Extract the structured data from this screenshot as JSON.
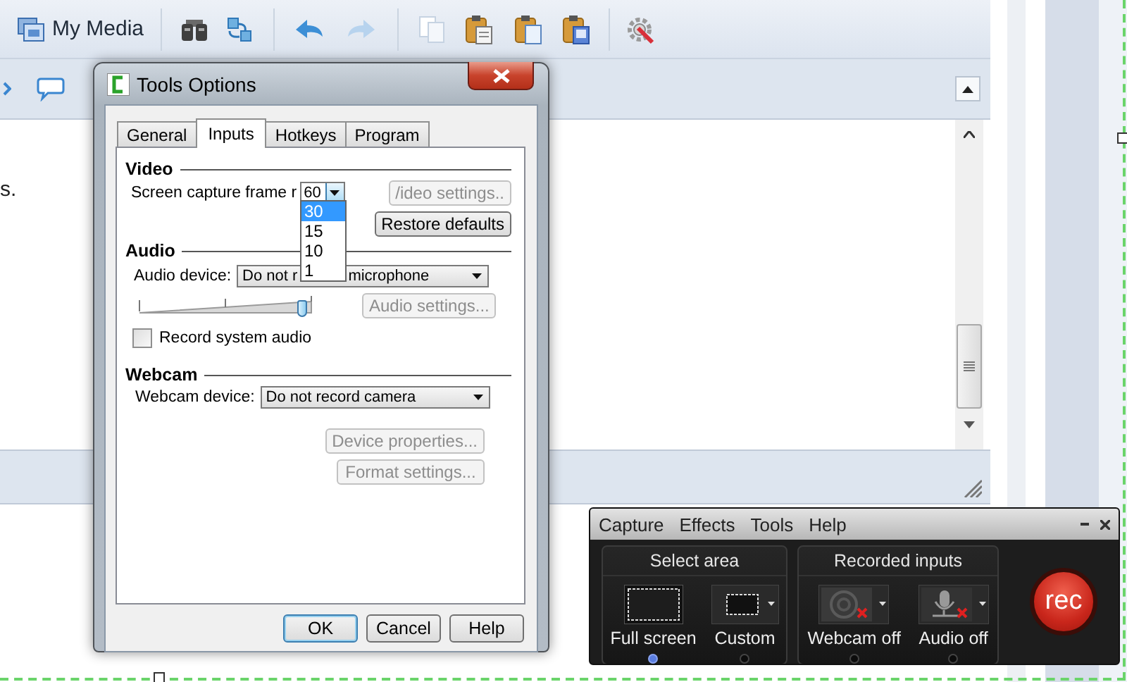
{
  "app": {
    "media_button": "My Media",
    "document_text": "s."
  },
  "dialog": {
    "title": "Tools Options",
    "tabs": [
      {
        "label": "General",
        "selected": false
      },
      {
        "label": "Inputs",
        "selected": true
      },
      {
        "label": "Hotkeys",
        "selected": false
      },
      {
        "label": "Program",
        "selected": false
      }
    ],
    "video": {
      "heading": "Video",
      "frame_rate_label": "Screen capture frame r",
      "frame_rate_value": "60",
      "frame_rate_expanded": true,
      "frame_rate_options": [
        {
          "label": "30",
          "selected": true
        },
        {
          "label": "15",
          "selected": false
        },
        {
          "label": "10",
          "selected": false
        },
        {
          "label": "1",
          "selected": false
        }
      ],
      "settings_button": {
        "label": "/ideo settings..",
        "disabled": true
      },
      "restore_button": {
        "label": "Restore defaults",
        "disabled": false
      }
    },
    "audio": {
      "heading": "Audio",
      "device_label": "Audio device:",
      "device_value_parts": [
        "Do not r",
        "microphone"
      ],
      "volume": {
        "level": 0.97
      },
      "settings_button": {
        "label": "Audio settings...",
        "disabled": true
      },
      "record_system_audio": {
        "label": "Record system audio",
        "checked": false
      }
    },
    "webcam": {
      "heading": "Webcam",
      "device_label": "Webcam device:",
      "device_value": "Do not record camera",
      "properties_button": {
        "label": "Device properties...",
        "disabled": true
      },
      "format_button": {
        "label": "Format settings...",
        "disabled": true
      }
    },
    "buttons": [
      {
        "label": "OK",
        "default": true
      },
      {
        "label": "Cancel",
        "default": false
      },
      {
        "label": "Help",
        "default": false
      }
    ]
  },
  "recorder": {
    "menu": [
      "Capture",
      "Effects",
      "Tools",
      "Help"
    ],
    "groups": [
      {
        "title": "Select area",
        "items": [
          {
            "kind": "fullscreen",
            "label": "Full screen",
            "selected": true
          },
          {
            "kind": "custom",
            "label": "Custom",
            "selected": false
          }
        ]
      },
      {
        "title": "Recorded inputs",
        "items": [
          {
            "kind": "webcam",
            "label": "Webcam off",
            "on": false
          },
          {
            "kind": "audio",
            "label": "Audio off",
            "on": false
          }
        ]
      }
    ],
    "rec_button": "rec"
  }
}
